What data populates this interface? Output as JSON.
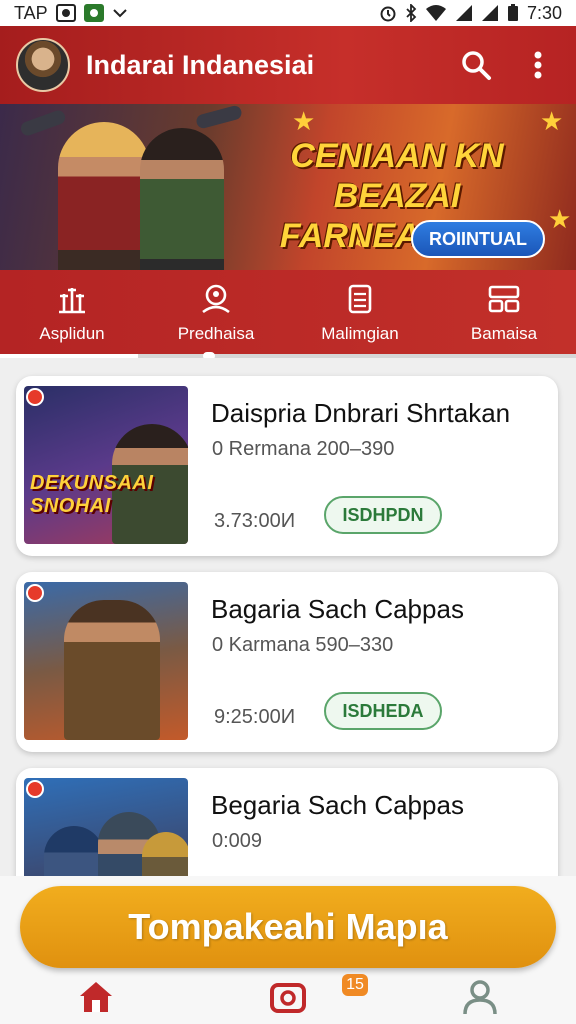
{
  "status_bar": {
    "carrier": "TAP",
    "time": "7:30",
    "icons": [
      "image-icon",
      "whatsapp-icon",
      "chevron-down-icon",
      "alarm-icon",
      "bluetooth-icon",
      "wifi-icon",
      "signal-icon",
      "signal-icon",
      "battery-icon"
    ]
  },
  "header": {
    "title": "Indarai Indanesiai",
    "icons": [
      "avatar",
      "search-icon",
      "more-vert-icon"
    ]
  },
  "banner": {
    "headline_line1": "CENIAAN KN BEAZAI",
    "headline_line2": "FARNEAI MN!!",
    "button_label": "ROIINTUAL"
  },
  "categories": [
    {
      "label": "Asplidun",
      "icon": "tower-icon"
    },
    {
      "label": "Predhaisa",
      "icon": "person-pin-icon"
    },
    {
      "label": "Malimgian",
      "icon": "clipboard-icon"
    },
    {
      "label": "Bamaisa",
      "icon": "grid-icon"
    }
  ],
  "cards": [
    {
      "title": "Daispria Dnbrari Shrtakan",
      "subtitle": "0 Rermana  200–390",
      "time": "3.73:00И",
      "button": "IЅDHPDN",
      "thumb_text": "DEKUNSAAI\nSNOHAI"
    },
    {
      "title": "Bagaria Sach Caþpas",
      "subtitle": "0 Karmana  590–330",
      "time": "9:25:00И",
      "button": "IЅDHEDA",
      "thumb_text": ""
    },
    {
      "title": "Begaria Sach Caþpas",
      "subtitle": "0:009",
      "time": "",
      "button": "",
      "thumb_text": ""
    }
  ],
  "cta": {
    "label": "Tompakeahi Mapıa"
  },
  "bottom_nav": [
    {
      "icon": "home-icon"
    },
    {
      "icon": "camera-icon",
      "badge": "15"
    },
    {
      "icon": "person-icon"
    }
  ],
  "colors": {
    "primary": "#c0292a",
    "cta": "#ec9d17",
    "button_green": "#5aa56a",
    "banner_button": "#1f65c9"
  }
}
